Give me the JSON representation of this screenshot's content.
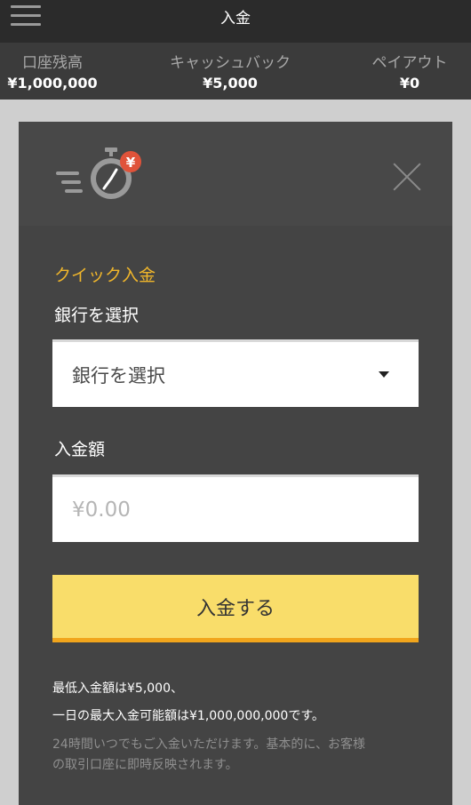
{
  "header": {
    "title": "入金",
    "menu_icon": "hamburger-menu-icon"
  },
  "stats": {
    "balance": {
      "label": "口座残高",
      "value": "¥1,000,000"
    },
    "cashback": {
      "label": "キャッシュバック",
      "value": "¥5,000"
    },
    "payout": {
      "label": "ペイアウト",
      "value": "¥0"
    }
  },
  "modal": {
    "logo_icon": "fast-stopwatch-yen-icon",
    "logo_badge": "¥",
    "close_icon": "close-icon",
    "section_title": "クイック入金",
    "bank": {
      "label": "銀行を選択",
      "selected": "銀行を選択"
    },
    "amount": {
      "label": "入金額",
      "placeholder": "¥0.00",
      "value": ""
    },
    "submit_label": "入金する",
    "notes": {
      "min": "最低入金額は¥5,000、",
      "max": "一日の最大入金可能額は¥1,000,000,000です。",
      "info_line1": "24時間いつでもご入金いただけます。基本的に、お客様",
      "info_line2": "の取引口座に即時反映されます。"
    }
  },
  "colors": {
    "accent_yellow": "#f9dd6a",
    "accent_orange": "#f1a51c",
    "section_title": "#f0b62b",
    "badge_red": "#e0533a"
  }
}
